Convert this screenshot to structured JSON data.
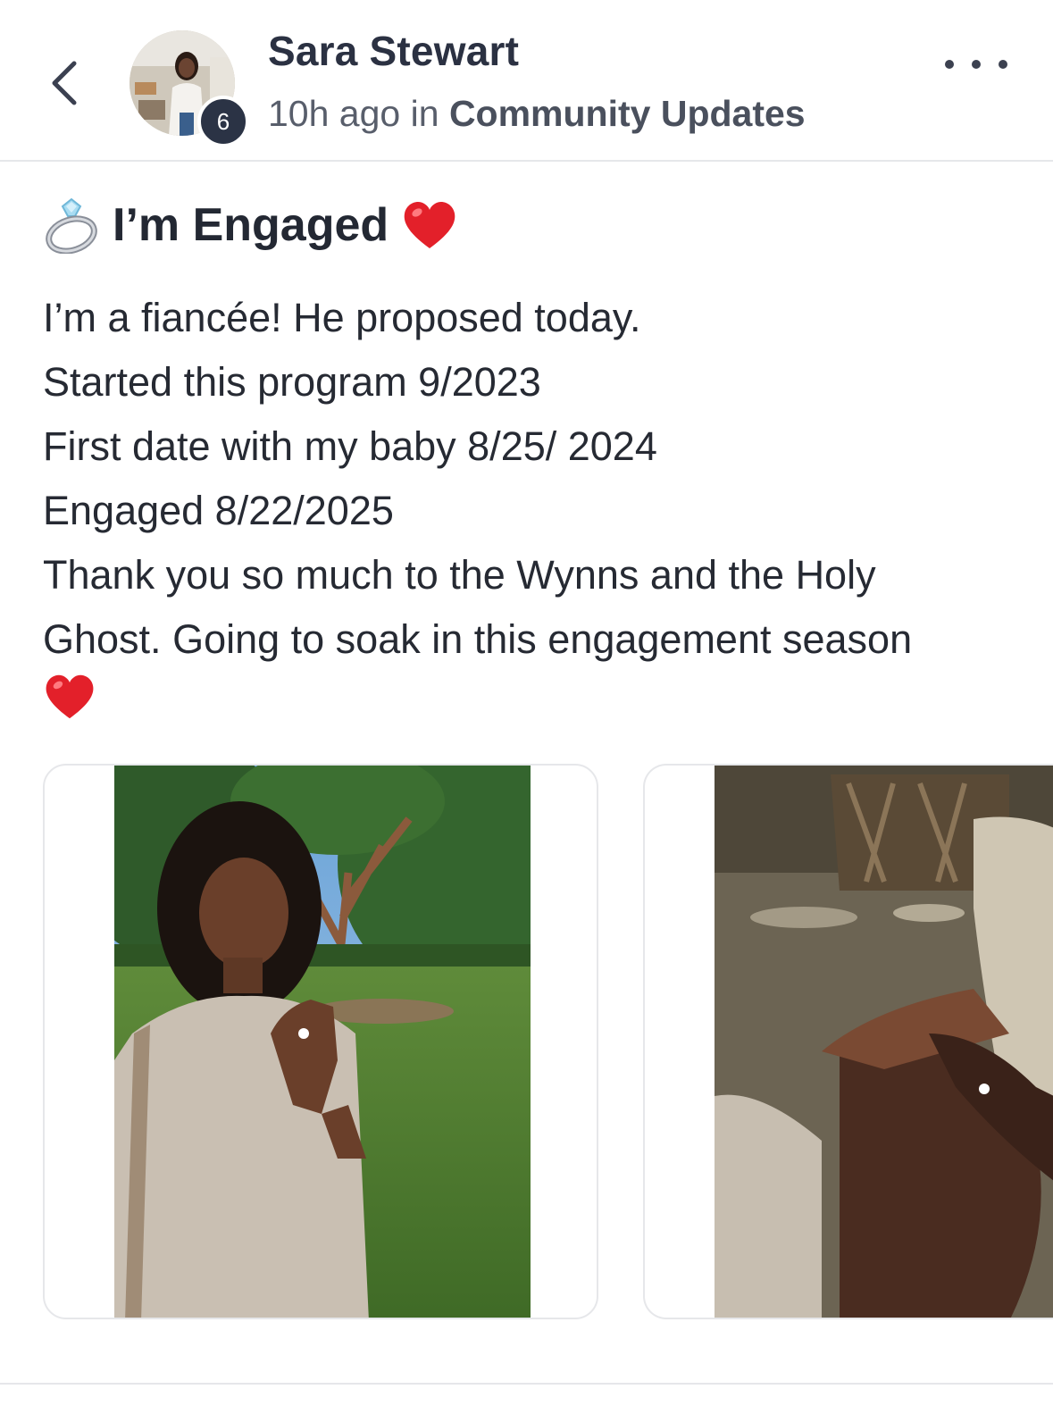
{
  "post": {
    "author": {
      "name": "Sara Stewart",
      "level": "6"
    },
    "meta": {
      "time": "10h ago",
      "in_word": "in",
      "category": "Community Updates"
    },
    "title": "I’m Engaged",
    "title_icons": [
      "ring-icon",
      "red-heart-icon"
    ],
    "body_lines": [
      "I’m a fiancée! He proposed today.",
      "Started this program 9/2023",
      "First date with my baby 8/25/ 2024",
      "Engaged 8/22/2025",
      "Thank you so much to the Wynns and the Holy",
      "Ghost. Going to soak in this engagement season"
    ],
    "body_end_icon": "red-heart-icon",
    "media_count": 2
  },
  "colors": {
    "text_primary": "#232833",
    "text_meta": "#585e6b",
    "badge_bg": "#2b3345",
    "divider": "#e6e7ea",
    "heart_red": "#e3202a"
  }
}
